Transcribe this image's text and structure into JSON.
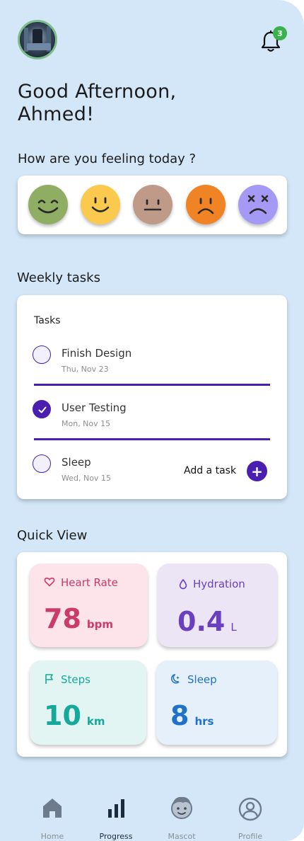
{
  "header": {
    "notification_count": "3",
    "greeting_line1": "Good Afternoon,",
    "greeting_line2": "Ahmed!"
  },
  "mood": {
    "title": "How are you feeling today ?",
    "options": [
      {
        "name": "happy",
        "color": "#8fad63"
      },
      {
        "name": "content",
        "color": "#fbc94e"
      },
      {
        "name": "neutral",
        "color": "#bf9a88"
      },
      {
        "name": "sad",
        "color": "#f08424"
      },
      {
        "name": "awful",
        "color": "#a49af6"
      }
    ]
  },
  "weekly_tasks": {
    "section_title": "Weekly tasks",
    "card_title": "Tasks",
    "items": [
      {
        "name": "Finish Design",
        "date": "Thu, Nov 23",
        "done": false
      },
      {
        "name": "User Testing",
        "date": "Mon, Nov 15",
        "done": true
      },
      {
        "name": "Sleep",
        "date": "Wed, Nov 15",
        "done": false
      }
    ],
    "add_label": "Add a task",
    "add_symbol": "+"
  },
  "quick_view": {
    "section_title": "Quick View",
    "stats": [
      {
        "label": "Heart Rate",
        "value": "78",
        "unit": "bpm",
        "icon": "heart-icon",
        "bg": "#fce4ea",
        "color": "#cc3a6a"
      },
      {
        "label": "Hydration",
        "value": "0.4",
        "unit": "L",
        "icon": "droplet-icon",
        "bg": "#ebe5f6",
        "color": "#6a3fc0"
      },
      {
        "label": "Steps",
        "value": "10",
        "unit": "km",
        "icon": "flag-icon",
        "bg": "#e3f5f2",
        "color": "#14a99b"
      },
      {
        "label": "Sleep",
        "value": "8",
        "unit": "hrs",
        "icon": "moon-icon",
        "bg": "#e6f0fa",
        "color": "#1f72c7"
      }
    ]
  },
  "nav": {
    "items": [
      {
        "label": "Home",
        "icon": "home-icon",
        "active": false
      },
      {
        "label": "Progress",
        "icon": "bar-chart-icon",
        "active": true
      },
      {
        "label": "Mascot",
        "icon": "mascot-icon",
        "active": false
      },
      {
        "label": "Profile",
        "icon": "user-icon",
        "active": false
      }
    ]
  },
  "colors": {
    "background": "#d3e7f8",
    "accent": "#4a1fb0",
    "badge": "#38b24a"
  }
}
